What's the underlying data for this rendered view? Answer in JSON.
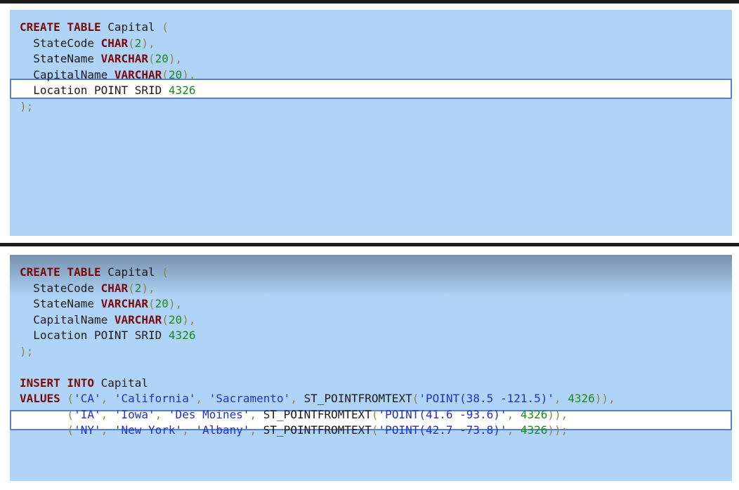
{
  "top_panel": {
    "lines": [
      [
        {
          "t": "CREATE TABLE",
          "c": "kw"
        },
        {
          "t": " Capital ",
          "c": "id"
        },
        {
          "t": "(",
          "c": "pun"
        }
      ],
      [
        {
          "t": "  StateCode ",
          "c": "id"
        },
        {
          "t": "CHAR",
          "c": "kw"
        },
        {
          "t": "(",
          "c": "pun"
        },
        {
          "t": "2",
          "c": "num"
        },
        {
          "t": "),",
          "c": "pun"
        }
      ],
      [
        {
          "t": "  StateName ",
          "c": "id"
        },
        {
          "t": "VARCHAR",
          "c": "kw"
        },
        {
          "t": "(",
          "c": "pun"
        },
        {
          "t": "20",
          "c": "num"
        },
        {
          "t": "),",
          "c": "pun"
        }
      ],
      [
        {
          "t": "  CapitalName ",
          "c": "id"
        },
        {
          "t": "VARCHAR",
          "c": "kw"
        },
        {
          "t": "(",
          "c": "pun"
        },
        {
          "t": "20",
          "c": "num"
        },
        {
          "t": "),",
          "c": "pun"
        }
      ],
      [
        {
          "t": "  Location POINT SRID ",
          "c": "id"
        },
        {
          "t": "4326",
          "c": "num"
        }
      ],
      [
        {
          "t": ");",
          "c": "pun"
        }
      ]
    ]
  },
  "bottom_panel": {
    "lines": [
      [
        {
          "t": "CREATE TABLE",
          "c": "kw"
        },
        {
          "t": " Capital ",
          "c": "id"
        },
        {
          "t": "(",
          "c": "pun"
        }
      ],
      [
        {
          "t": "  StateCode ",
          "c": "id"
        },
        {
          "t": "CHAR",
          "c": "kw"
        },
        {
          "t": "(",
          "c": "pun"
        },
        {
          "t": "2",
          "c": "num"
        },
        {
          "t": "),",
          "c": "pun"
        }
      ],
      [
        {
          "t": "  StateName ",
          "c": "id"
        },
        {
          "t": "VARCHAR",
          "c": "kw"
        },
        {
          "t": "(",
          "c": "pun"
        },
        {
          "t": "20",
          "c": "num"
        },
        {
          "t": "),",
          "c": "pun"
        }
      ],
      [
        {
          "t": "  CapitalName ",
          "c": "id"
        },
        {
          "t": "VARCHAR",
          "c": "kw"
        },
        {
          "t": "(",
          "c": "pun"
        },
        {
          "t": "20",
          "c": "num"
        },
        {
          "t": "),",
          "c": "pun"
        }
      ],
      [
        {
          "t": "  Location POINT SRID ",
          "c": "id"
        },
        {
          "t": "4326",
          "c": "num"
        }
      ],
      [
        {
          "t": ");",
          "c": "pun"
        }
      ],
      [],
      [
        {
          "t": "INSERT INTO",
          "c": "kw"
        },
        {
          "t": " Capital",
          "c": "id"
        }
      ],
      [
        {
          "t": "VALUES",
          "c": "kw"
        },
        {
          "t": " (",
          "c": "pun"
        },
        {
          "t": "'CA'",
          "c": "str"
        },
        {
          "t": ", ",
          "c": "pun"
        },
        {
          "t": "'California'",
          "c": "str"
        },
        {
          "t": ", ",
          "c": "pun"
        },
        {
          "t": "'Sacramento'",
          "c": "str"
        },
        {
          "t": ", ",
          "c": "pun"
        },
        {
          "t": "ST_POINTFROMTEXT",
          "c": "id"
        },
        {
          "t": "(",
          "c": "pun"
        },
        {
          "t": "'POINT(38.5 -121.5)'",
          "c": "str"
        },
        {
          "t": ", ",
          "c": "pun"
        },
        {
          "t": "4326",
          "c": "num"
        },
        {
          "t": ")),",
          "c": "pun"
        }
      ],
      [
        {
          "t": "       (",
          "c": "pun"
        },
        {
          "t": "'IA'",
          "c": "str"
        },
        {
          "t": ", ",
          "c": "pun"
        },
        {
          "t": "'Iowa'",
          "c": "str"
        },
        {
          "t": ", ",
          "c": "pun"
        },
        {
          "t": "'Des Moines'",
          "c": "str"
        },
        {
          "t": ", ",
          "c": "pun"
        },
        {
          "t": "ST_POINTFROMTEXT",
          "c": "id"
        },
        {
          "t": "(",
          "c": "pun"
        },
        {
          "t": "'POINT(41.6 -93.6)'",
          "c": "str"
        },
        {
          "t": ", ",
          "c": "pun"
        },
        {
          "t": "4326",
          "c": "num"
        },
        {
          "t": ")),",
          "c": "pun"
        }
      ],
      [
        {
          "t": "       (",
          "c": "pun"
        },
        {
          "t": "'NY'",
          "c": "str"
        },
        {
          "t": ", ",
          "c": "pun"
        },
        {
          "t": "'New York'",
          "c": "str"
        },
        {
          "t": ", ",
          "c": "pun"
        },
        {
          "t": "'Albany'",
          "c": "str"
        },
        {
          "t": ", ",
          "c": "pun"
        },
        {
          "t": "ST_POINTFROMTEXT",
          "c": "id"
        },
        {
          "t": "(",
          "c": "pun"
        },
        {
          "t": "'POINT(42.7 -73.8)'",
          "c": "str"
        },
        {
          "t": ", ",
          "c": "pun"
        },
        {
          "t": "4326",
          "c": "num"
        },
        {
          "t": "));",
          "c": "pun"
        }
      ]
    ]
  }
}
